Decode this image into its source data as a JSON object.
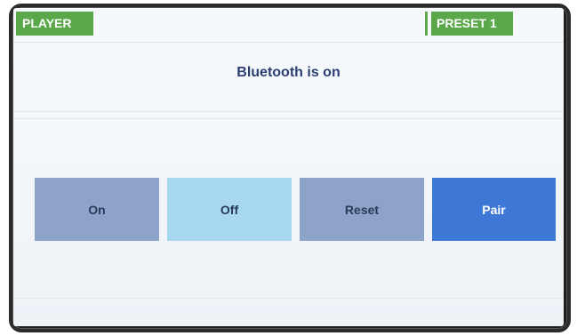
{
  "header": {
    "left_tag": "PLAYER",
    "right_tag": "PRESET 1"
  },
  "status": {
    "text": "Bluetooth is on"
  },
  "buttons": [
    {
      "label": "On"
    },
    {
      "label": "Off"
    },
    {
      "label": "Reset"
    },
    {
      "label": "Pair"
    }
  ],
  "colors": {
    "tag_green": "#5aa84a",
    "button_default": "#8da3c9",
    "button_off_highlight": "#a8d7f2",
    "button_pair_accent": "#3d78d6",
    "status_text": "#2c3e73"
  }
}
